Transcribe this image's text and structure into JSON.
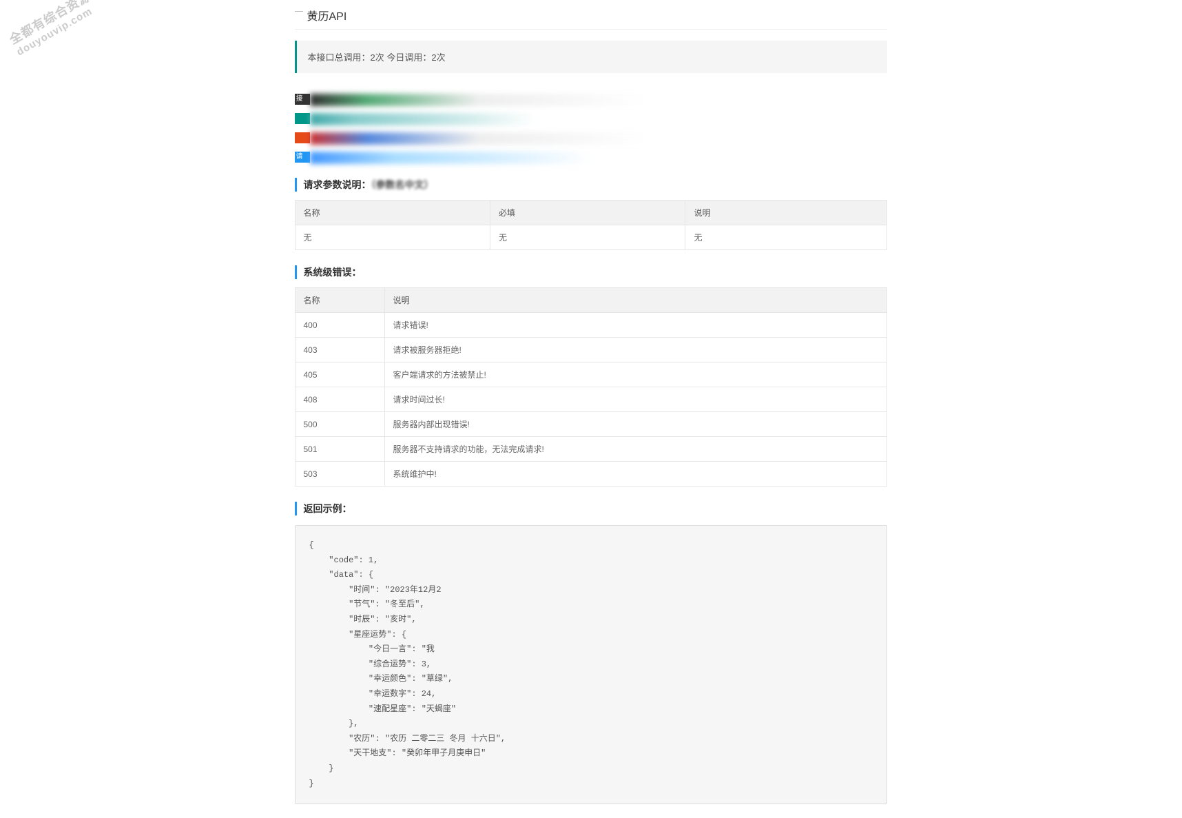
{
  "watermark": {
    "line1": "全都有综合资源网",
    "line2": "douyouvip.com"
  },
  "title": "黄历API",
  "callout": "本接口总调用：2次 今日调用：2次",
  "obscured_labels": {
    "tab1": "接口",
    "tab4": "请"
  },
  "params_section": {
    "heading": "请求参数说明：",
    "heading_blur_suffix": "（参数名中文）",
    "cols": [
      "名称",
      "必填",
      "说明"
    ],
    "rows": [
      {
        "name": "无",
        "required": "无",
        "desc": "无"
      }
    ]
  },
  "errors_section": {
    "heading": "系统级错误：",
    "cols": [
      "名称",
      "说明"
    ],
    "rows": [
      {
        "code": "400",
        "msg": "请求错误!"
      },
      {
        "code": "403",
        "msg": "请求被服务器拒绝!"
      },
      {
        "code": "405",
        "msg": "客户端请求的方法被禁止!"
      },
      {
        "code": "408",
        "msg": "请求时间过长!"
      },
      {
        "code": "500",
        "msg": "服务器内部出现错误!"
      },
      {
        "code": "501",
        "msg": "服务器不支持请求的功能，无法完成请求!"
      },
      {
        "code": "503",
        "msg": "系统维护中!"
      }
    ]
  },
  "example_section": {
    "heading": "返回示例：",
    "code": "{\n    \"code\": 1,\n    \"data\": {\n        \"时间\": \"2023年12月2\n        \"节气\": \"冬至后\",\n        \"时辰\": \"亥时\",\n        \"星座运势\": {\n            \"今日一言\": \"我\n            \"综合运势\": 3,\n            \"幸运颜色\": \"草绿\",\n            \"幸运数字\": 24,\n            \"速配星座\": \"天蝎座\"\n        },\n        \"农历\": \"农历 二零二三 冬月 十六日\",\n        \"天干地支\": \"癸卯年甲子月庚申日\"\n    }\n}"
  }
}
